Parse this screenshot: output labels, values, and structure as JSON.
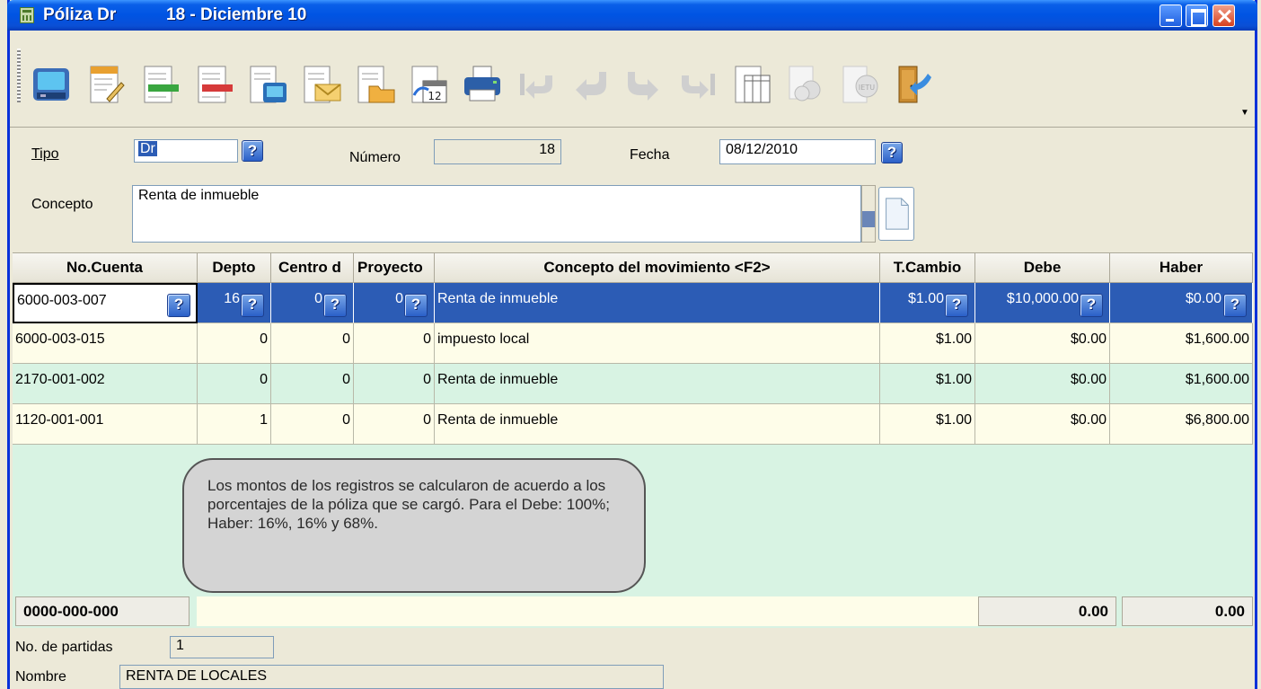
{
  "window": {
    "title": "Póliza Dr",
    "title_detail": "18 - Diciembre 10"
  },
  "toolbar": {
    "buttons": [
      "save-icon",
      "edit-document-icon",
      "add-row-icon",
      "delete-row-icon",
      "document-screen-icon",
      "document-email-icon",
      "open-folder-icon",
      "calendar-icon",
      "print-icon",
      "first-record-icon",
      "previous-record-icon",
      "next-record-icon",
      "last-record-icon",
      "columns-icon",
      "currency-icon",
      "ietu-icon",
      "exit-door-icon"
    ],
    "calendar_day": "12",
    "ietu_label": "IETU"
  },
  "header": {
    "tipo_label": "Tipo",
    "tipo_value": "Dr",
    "numero_label": "Número",
    "numero_value": "18",
    "fecha_label": "Fecha",
    "fecha_value": "08/12/2010",
    "concepto_label": "Concepto",
    "concepto_value": "Renta de inmueble",
    "help": "?"
  },
  "grid": {
    "columns": [
      "No.Cuenta",
      "Depto",
      "Centro d",
      "Proyecto",
      "Concepto del movimiento <F2>",
      "T.Cambio",
      "Debe",
      "Haber"
    ],
    "rows": [
      {
        "cuenta": "6000-003-007",
        "depto": "16",
        "centro": "0",
        "proyecto": "0",
        "concepto": "Renta de inmueble",
        "tcambio": "$1.00",
        "debe": "$10,000.00",
        "haber": "$0.00"
      },
      {
        "cuenta": "6000-003-015",
        "depto": "0",
        "centro": "0",
        "proyecto": "0",
        "concepto": "impuesto local",
        "tcambio": "$1.00",
        "debe": "$0.00",
        "haber": "$1,600.00"
      },
      {
        "cuenta": "2170-001-002",
        "depto": "0",
        "centro": "0",
        "proyecto": "0",
        "concepto": "Renta de inmueble",
        "tcambio": "$1.00",
        "debe": "$0.00",
        "haber": "$1,600.00"
      },
      {
        "cuenta": "1120-001-001",
        "depto": "1",
        "centro": "0",
        "proyecto": "0",
        "concepto": "Renta de inmueble",
        "tcambio": "$1.00",
        "debe": "$0.00",
        "haber": "$6,800.00"
      }
    ]
  },
  "callout": "Los montos de los registros se calcularon de acuerdo a los porcentajes de la póliza que se cargó. Para el Debe: 100%; Haber: 16%, 16% y 68%.",
  "totals": {
    "cuenta": "0000-000-000",
    "debe": "0.00",
    "haber": "0.00"
  },
  "footer": {
    "partidas_label": "No. de partidas",
    "partidas_value": "1",
    "nombre_label": "Nombre",
    "nombre_value": "RENTA DE LOCALES"
  },
  "colors": {
    "title_blue": "#0054e3",
    "selection": "#2c5cb5",
    "row_yellow": "#fefde9",
    "row_green": "#d8f3e3"
  }
}
